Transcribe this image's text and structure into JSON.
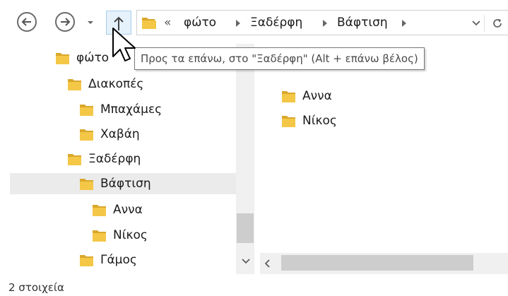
{
  "toolbar": {
    "back_icon": "arrow-left-icon",
    "forward_icon": "arrow-right-icon",
    "recent_icon": "chevron-down-icon",
    "up_icon": "arrow-up-icon",
    "refresh_icon": "refresh-icon"
  },
  "address_bar": {
    "overflow": "«",
    "crumbs": [
      "φώτο",
      "Ξαδέρφη",
      "Βάφτιση"
    ]
  },
  "tooltip": "Προς τα επάνω, στο \"Ξαδέρφη\" (Alt + επάνω βέλος)",
  "nav_tree": [
    {
      "label": "φώτο"
    },
    {
      "label": "Διακοπές"
    },
    {
      "label": "Μπαχάμες"
    },
    {
      "label": "Χαβάη"
    },
    {
      "label": "Ξαδέρφη"
    },
    {
      "label": "Βάφτιση",
      "selected": true
    },
    {
      "label": "Αννα"
    },
    {
      "label": "Νίκος"
    },
    {
      "label": "Γάμος"
    }
  ],
  "content_items": [
    {
      "label": "Αννα"
    },
    {
      "label": "Νίκος"
    }
  ],
  "status_bar": "2 στοιχεία",
  "colors": {
    "folder_yellow": "#f4c747",
    "folder_dark": "#d9a82c",
    "selection_bg": "#ebebeb",
    "hover_bg": "#e5f1fb"
  }
}
